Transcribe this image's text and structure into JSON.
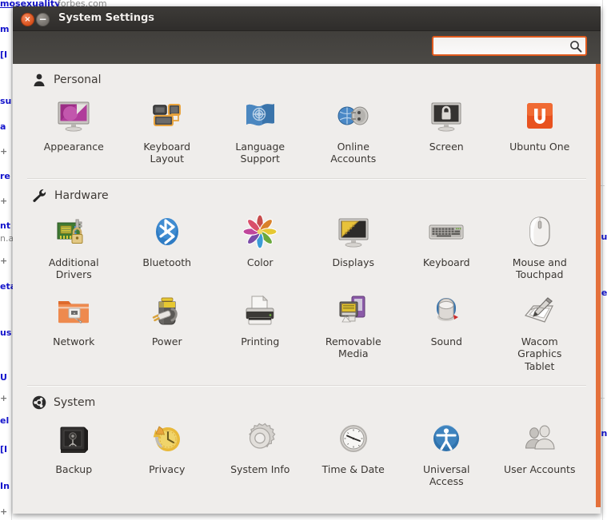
{
  "background": {
    "links": [
      "mosexuality",
      "m",
      "[I",
      "su",
      "a",
      "re",
      "nt",
      "eta",
      "us",
      "U",
      "el",
      "[I",
      "In",
      "ou",
      "ne",
      "en"
    ],
    "plain_text": [
      "forbes.com",
      "n.a"
    ],
    "plus_markers": [
      "+",
      "+",
      "+",
      "+",
      "+"
    ]
  },
  "window": {
    "title": "System Settings",
    "close_glyph": "×",
    "minimize_glyph": "−",
    "close_icon_name": "close-icon",
    "minimize_icon_name": "minimize-icon",
    "accent_color": "#e05a1e"
  },
  "search": {
    "value": "",
    "placeholder": "",
    "icon": "search-icon"
  },
  "sections": [
    {
      "id": "personal",
      "title": "Personal",
      "header_icon": "person-icon",
      "items": [
        {
          "label": "Appearance",
          "icon": "appearance-icon"
        },
        {
          "label": "Keyboard Layout",
          "icon": "keyboard-layout-icon"
        },
        {
          "label": "Language Support",
          "icon": "language-support-icon"
        },
        {
          "label": "Online Accounts",
          "icon": "online-accounts-icon"
        },
        {
          "label": "Screen",
          "icon": "screen-lock-icon"
        },
        {
          "label": "Ubuntu One",
          "icon": "ubuntu-one-icon"
        }
      ]
    },
    {
      "id": "hardware",
      "title": "Hardware",
      "header_icon": "wrench-icon",
      "items": [
        {
          "label": "Additional Drivers",
          "icon": "additional-drivers-icon"
        },
        {
          "label": "Bluetooth",
          "icon": "bluetooth-icon"
        },
        {
          "label": "Color",
          "icon": "color-icon"
        },
        {
          "label": "Displays",
          "icon": "displays-icon"
        },
        {
          "label": "Keyboard",
          "icon": "keyboard-icon"
        },
        {
          "label": "Mouse and Touchpad",
          "icon": "mouse-touchpad-icon"
        },
        {
          "label": "Network",
          "icon": "network-icon"
        },
        {
          "label": "Power",
          "icon": "power-icon"
        },
        {
          "label": "Printing",
          "icon": "printing-icon"
        },
        {
          "label": "Removable Media",
          "icon": "removable-media-icon"
        },
        {
          "label": "Sound",
          "icon": "sound-icon"
        },
        {
          "label": "Wacom Graphics Tablet",
          "icon": "wacom-tablet-icon"
        }
      ]
    },
    {
      "id": "system",
      "title": "System",
      "header_icon": "ubuntu-logo-icon",
      "items": [
        {
          "label": "Backup",
          "icon": "backup-icon"
        },
        {
          "label": "Privacy",
          "icon": "privacy-icon"
        },
        {
          "label": "System Info",
          "icon": "system-info-icon"
        },
        {
          "label": "Time & Date",
          "icon": "time-date-icon"
        },
        {
          "label": "Universal Access",
          "icon": "universal-access-icon"
        },
        {
          "label": "User Accounts",
          "icon": "user-accounts-icon"
        }
      ]
    }
  ]
}
